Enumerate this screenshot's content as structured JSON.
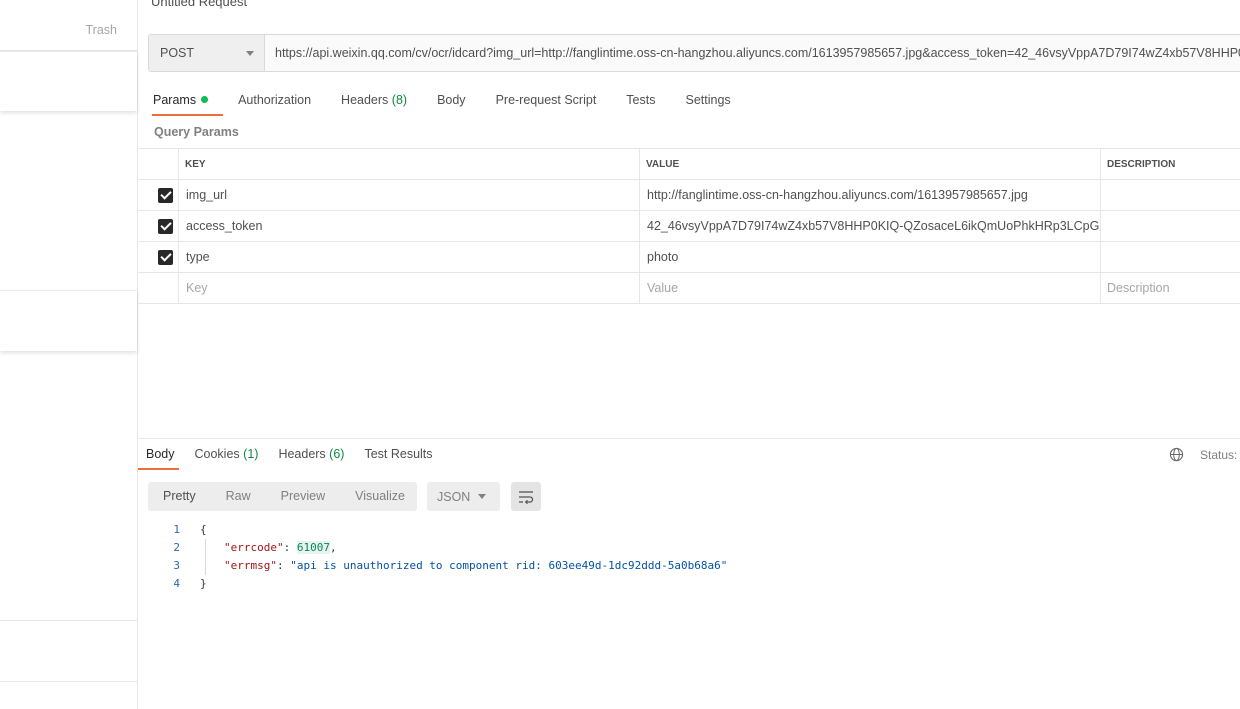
{
  "sidebar": {
    "trash_label": "Trash"
  },
  "request": {
    "title": "Untitled Request",
    "method": "POST",
    "url": "https://api.weixin.qq.com/cv/ocr/idcard?img_url=http://fanglintime.oss-cn-hangzhou.aliyuncs.com/1613957985657.jpg&access_token=42_46vsyVppA7D79I74wZ4xb57V8HHP0"
  },
  "tabs": {
    "params": "Params",
    "authorization": "Authorization",
    "headers": "Headers",
    "headers_count": "(8)",
    "body": "Body",
    "prerequest": "Pre-request Script",
    "tests": "Tests",
    "settings": "Settings"
  },
  "query_params": {
    "label": "Query Params",
    "columns": {
      "key": "KEY",
      "value": "VALUE",
      "description": "DESCRIPTION"
    },
    "rows": [
      {
        "key": "img_url",
        "value": "http://fanglintime.oss-cn-hangzhou.aliyuncs.com/1613957985657.jpg",
        "checked": true
      },
      {
        "key": "access_token",
        "value": "42_46vsyVppA7D79I74wZ4xb57V8HHP0KIQ-QZosaceL6ikQmUoPhkHRp3LCpG...",
        "checked": true
      },
      {
        "key": "type",
        "value": "photo",
        "checked": true
      }
    ],
    "placeholders": {
      "key": "Key",
      "value": "Value",
      "description": "Description"
    }
  },
  "response": {
    "tabs": {
      "body": "Body",
      "cookies": "Cookies",
      "cookies_count": "(1)",
      "headers": "Headers",
      "headers_count": "(6)",
      "test_results": "Test Results"
    },
    "status_label": "Status:",
    "formats": {
      "pretty": "Pretty",
      "raw": "Raw",
      "preview": "Preview",
      "visualize": "Visualize"
    },
    "language": "JSON",
    "lines": {
      "n1": "1",
      "n2": "2",
      "n3": "3",
      "n4": "4",
      "open": "{",
      "errcode_key": "\"errcode\"",
      "errcode_val": "61007",
      "errmsg_key": "\"errmsg\"",
      "errmsg_val": "\"api is unauthorized to component rid: 603ee49d-1dc92ddd-5a0b68a6\"",
      "close": "}"
    }
  },
  "colors": {
    "accent": "#f26b3a",
    "count_green": "#0f8a43",
    "dot_green": "#0cbb52"
  },
  "icons": {
    "globe": "globe-icon",
    "wrap": "wrap-lines-icon",
    "check": "checkbox-checked-icon",
    "caret": "chevron-down-icon"
  }
}
